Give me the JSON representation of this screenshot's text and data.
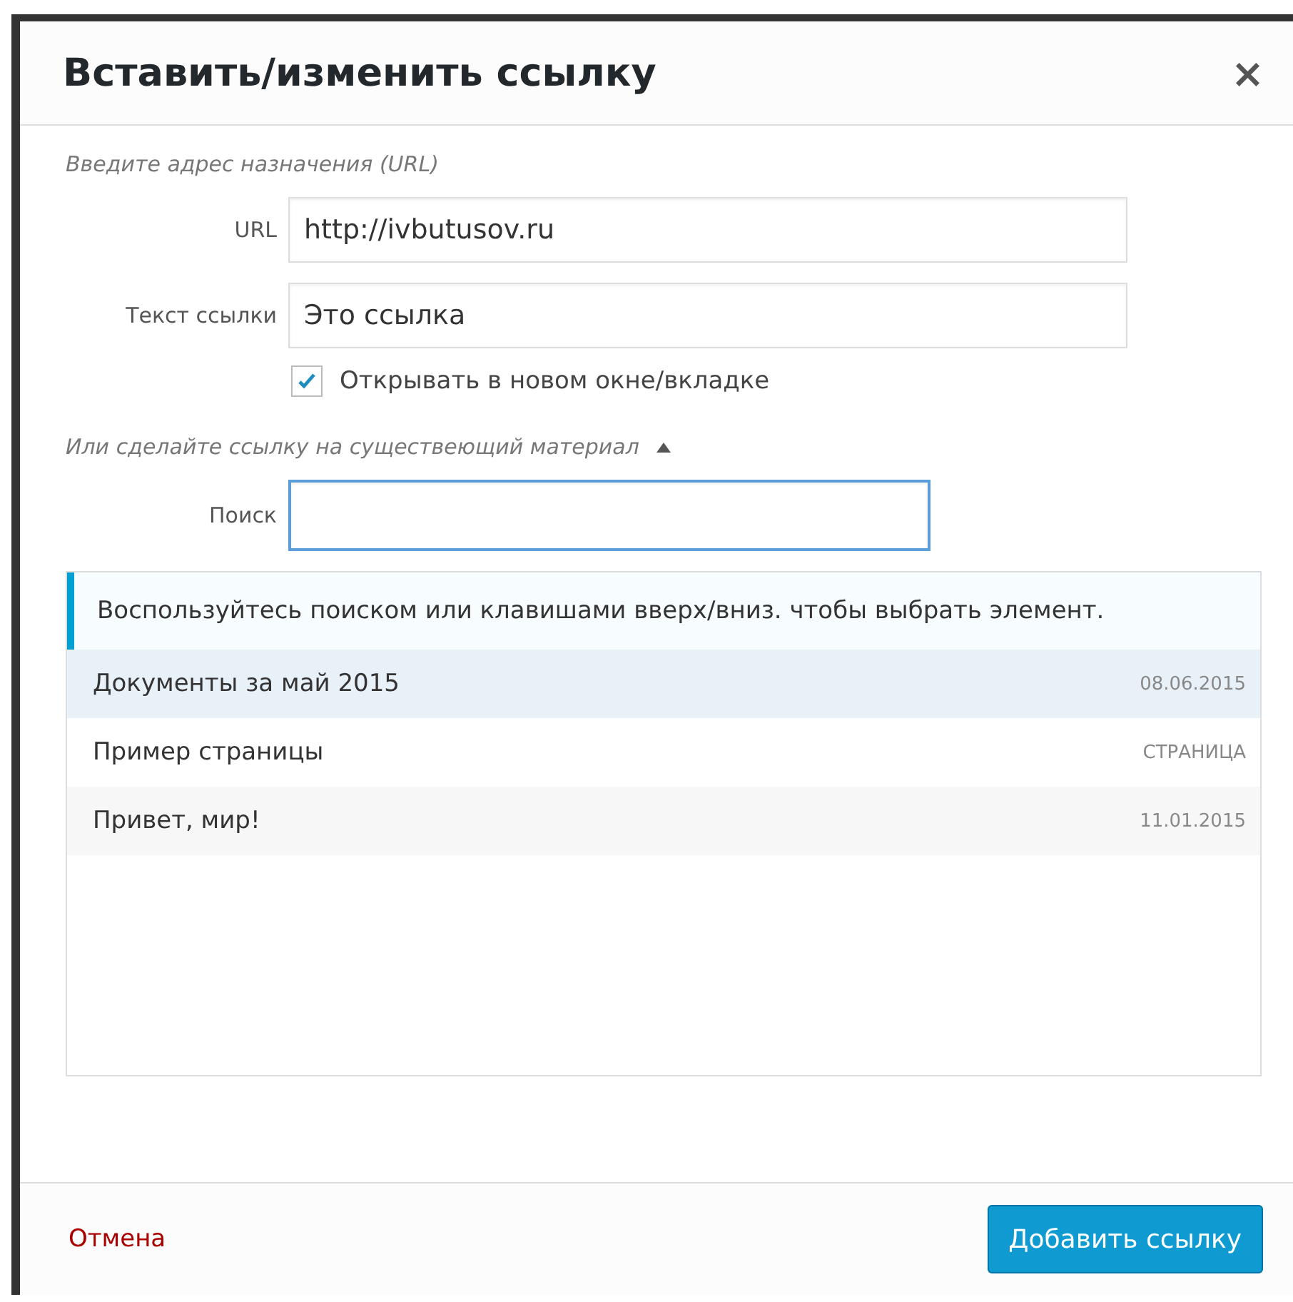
{
  "dialog": {
    "title": "Вставить/изменить ссылку",
    "close": "×"
  },
  "url_section": {
    "heading": "Введите адрес назначения (URL)",
    "fields": [
      {
        "label": "URL",
        "value": "http://ivbutusov.ru"
      },
      {
        "label": "Текст ссылки",
        "value": "Это ссылка"
      }
    ],
    "new_tab": {
      "label": "Открывать в новом окне/вкладке",
      "checked": true
    }
  },
  "link_section": {
    "heading": "Или сделайте ссылку на существеющий материал",
    "expanded": true,
    "search": {
      "label": "Поиск",
      "focused": true
    },
    "hint": "Воспользуйтесь поиском или клавишами вверх/вниз. чтобы выбрать элемент.",
    "results": [
      {
        "title": "Документы за май 2015",
        "meta": "08.06.2015",
        "selected": true
      },
      {
        "title": "Пример страницы",
        "meta": "СТРАНИЦА",
        "selected": false
      },
      {
        "title": "Привет, мир!",
        "meta": "11.01.2015",
        "selected": false
      }
    ]
  },
  "footer": {
    "cancel": "Отмена",
    "submit": "Добавить ссылку"
  }
}
